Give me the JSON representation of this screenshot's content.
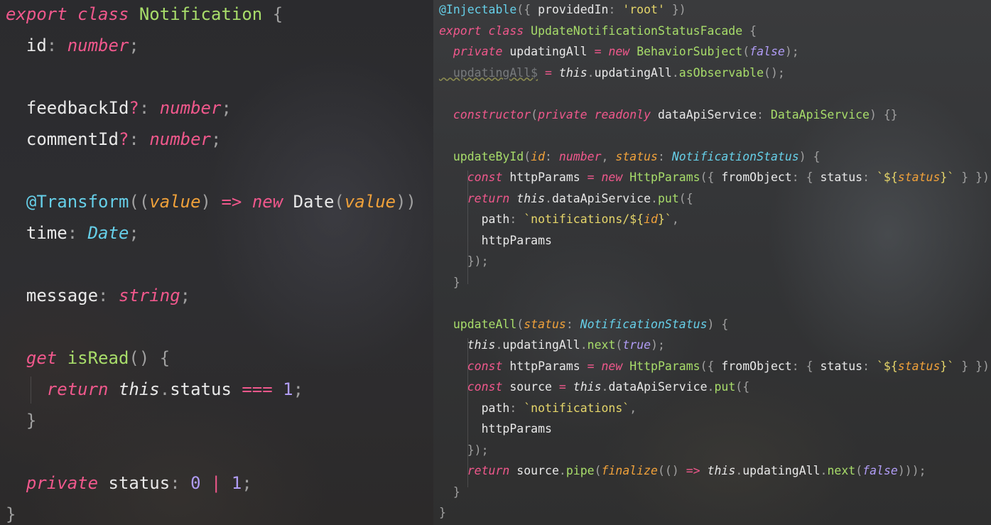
{
  "left_editor": {
    "lines": [
      [
        [
          "kw",
          "export "
        ],
        [
          "kw",
          "class "
        ],
        [
          "cls",
          "Notification"
        ],
        [
          "punc",
          " {"
        ]
      ],
      [
        [
          "ident",
          "  id"
        ],
        [
          "punc",
          ": "
        ],
        [
          "typ",
          "number"
        ],
        [
          "punc",
          ";"
        ]
      ],
      [],
      [
        [
          "ident",
          "  feedbackId"
        ],
        [
          "op",
          "?"
        ],
        [
          "punc",
          ": "
        ],
        [
          "typ",
          "number"
        ],
        [
          "punc",
          ";"
        ]
      ],
      [
        [
          "ident",
          "  commentId"
        ],
        [
          "op",
          "?"
        ],
        [
          "punc",
          ": "
        ],
        [
          "typ",
          "number"
        ],
        [
          "punc",
          ";"
        ]
      ],
      [],
      [
        [
          "dec",
          "  @Transform"
        ],
        [
          "punc",
          "(("
        ],
        [
          "param",
          "value"
        ],
        [
          "punc",
          ") "
        ],
        [
          "op",
          "=> "
        ],
        [
          "kw",
          "new "
        ],
        [
          "ident",
          "Date"
        ],
        [
          "punc",
          "("
        ],
        [
          "param",
          "value"
        ],
        [
          "punc",
          "))"
        ]
      ],
      [
        [
          "ident",
          "  time"
        ],
        [
          "punc",
          ": "
        ],
        [
          "typ-b",
          "Date"
        ],
        [
          "punc",
          ";"
        ]
      ],
      [],
      [
        [
          "ident",
          "  message"
        ],
        [
          "punc",
          ": "
        ],
        [
          "typ",
          "string"
        ],
        [
          "punc",
          ";"
        ]
      ],
      [],
      [
        [
          "kw",
          "  get "
        ],
        [
          "cls",
          "isRead"
        ],
        [
          "punc",
          "() {"
        ]
      ],
      [
        [
          "kw",
          "    return "
        ],
        [
          "this",
          "this"
        ],
        [
          "punc",
          "."
        ],
        [
          "ident",
          "status "
        ],
        [
          "op",
          "=== "
        ],
        [
          "num",
          "1"
        ],
        [
          "punc",
          ";"
        ]
      ],
      [
        [
          "punc",
          "  }"
        ]
      ],
      [],
      [
        [
          "kw",
          "  private "
        ],
        [
          "ident",
          "status"
        ],
        [
          "punc",
          ": "
        ],
        [
          "num",
          "0 "
        ],
        [
          "op",
          "| "
        ],
        [
          "num",
          "1"
        ],
        [
          "punc",
          ";"
        ]
      ],
      [
        [
          "punc",
          "}"
        ]
      ]
    ]
  },
  "right_editor": {
    "lines": [
      [
        [
          "dec",
          "@Injectable"
        ],
        [
          "punc",
          "({ "
        ],
        [
          "ident",
          "providedIn"
        ],
        [
          "punc",
          ": "
        ],
        [
          "str",
          "'root'"
        ],
        [
          "punc",
          " })"
        ]
      ],
      [
        [
          "kw",
          "export "
        ],
        [
          "kw",
          "class "
        ],
        [
          "cls",
          "UpdateNotificationStatusFacade"
        ],
        [
          "punc",
          " {"
        ]
      ],
      [
        [
          "kw",
          "  private "
        ],
        [
          "ident",
          "updatingAll "
        ],
        [
          "op",
          "= "
        ],
        [
          "kw",
          "new "
        ],
        [
          "cls",
          "BehaviorSubject"
        ],
        [
          "punc",
          "("
        ],
        [
          "bool",
          "false"
        ],
        [
          "punc",
          ");"
        ]
      ],
      [
        [
          "dim",
          "  updatingAll$"
        ],
        [
          "ident",
          " "
        ],
        [
          "op",
          "= "
        ],
        [
          "this",
          "this"
        ],
        [
          "punc",
          "."
        ],
        [
          "ident",
          "updatingAll"
        ],
        [
          "punc",
          "."
        ],
        [
          "fn",
          "asObservable"
        ],
        [
          "punc",
          "();"
        ]
      ],
      [],
      [
        [
          "kw",
          "  constructor"
        ],
        [
          "punc",
          "("
        ],
        [
          "kw",
          "private "
        ],
        [
          "kw",
          "readonly "
        ],
        [
          "ident",
          "dataApiService"
        ],
        [
          "punc",
          ": "
        ],
        [
          "tyc",
          "DataApiService"
        ],
        [
          "punc",
          ") {}"
        ]
      ],
      [],
      [
        [
          "fn",
          "  updateById"
        ],
        [
          "punc",
          "("
        ],
        [
          "param",
          "id"
        ],
        [
          "punc",
          ": "
        ],
        [
          "typ",
          "number"
        ],
        [
          "punc",
          ", "
        ],
        [
          "param",
          "status"
        ],
        [
          "punc",
          ": "
        ],
        [
          "typ-b",
          "NotificationStatus"
        ],
        [
          "punc",
          ") {"
        ]
      ],
      [
        [
          "kw",
          "    const "
        ],
        [
          "ident",
          "httpParams "
        ],
        [
          "op",
          "= "
        ],
        [
          "kw",
          "new "
        ],
        [
          "cls",
          "HttpParams"
        ],
        [
          "punc",
          "({ "
        ],
        [
          "ident",
          "fromObject"
        ],
        [
          "punc",
          ": { "
        ],
        [
          "ident",
          "status"
        ],
        [
          "punc",
          ": "
        ],
        [
          "str",
          "`${"
        ],
        [
          "tpl",
          "status"
        ],
        [
          "str",
          "}`"
        ],
        [
          "punc",
          " } });"
        ]
      ],
      [
        [
          "kw",
          "    return "
        ],
        [
          "this",
          "this"
        ],
        [
          "punc",
          "."
        ],
        [
          "ident",
          "dataApiService"
        ],
        [
          "punc",
          "."
        ],
        [
          "fn",
          "put"
        ],
        [
          "punc",
          "({"
        ]
      ],
      [
        [
          "ident",
          "      path"
        ],
        [
          "punc",
          ": "
        ],
        [
          "str",
          "`notifications/${"
        ],
        [
          "tpl",
          "id"
        ],
        [
          "str",
          "}`"
        ],
        [
          "punc",
          ","
        ]
      ],
      [
        [
          "ident",
          "      httpParams"
        ]
      ],
      [
        [
          "punc",
          "    });"
        ]
      ],
      [
        [
          "punc",
          "  }"
        ]
      ],
      [],
      [
        [
          "fn",
          "  updateAll"
        ],
        [
          "punc",
          "("
        ],
        [
          "param",
          "status"
        ],
        [
          "punc",
          ": "
        ],
        [
          "typ-b",
          "NotificationStatus"
        ],
        [
          "punc",
          ") {"
        ]
      ],
      [
        [
          "this",
          "    this"
        ],
        [
          "punc",
          "."
        ],
        [
          "ident",
          "updatingAll"
        ],
        [
          "punc",
          "."
        ],
        [
          "fn",
          "next"
        ],
        [
          "punc",
          "("
        ],
        [
          "bool",
          "true"
        ],
        [
          "punc",
          ");"
        ]
      ],
      [
        [
          "kw",
          "    const "
        ],
        [
          "ident",
          "httpParams "
        ],
        [
          "op",
          "= "
        ],
        [
          "kw",
          "new "
        ],
        [
          "cls",
          "HttpParams"
        ],
        [
          "punc",
          "({ "
        ],
        [
          "ident",
          "fromObject"
        ],
        [
          "punc",
          ": { "
        ],
        [
          "ident",
          "status"
        ],
        [
          "punc",
          ": "
        ],
        [
          "str",
          "`${"
        ],
        [
          "tpl",
          "status"
        ],
        [
          "str",
          "}`"
        ],
        [
          "punc",
          " } });"
        ]
      ],
      [
        [
          "kw",
          "    const "
        ],
        [
          "ident",
          "source "
        ],
        [
          "op",
          "= "
        ],
        [
          "this",
          "this"
        ],
        [
          "punc",
          "."
        ],
        [
          "ident",
          "dataApiService"
        ],
        [
          "punc",
          "."
        ],
        [
          "fn",
          "put"
        ],
        [
          "punc",
          "({"
        ]
      ],
      [
        [
          "ident",
          "      path"
        ],
        [
          "punc",
          ": "
        ],
        [
          "str",
          "`notifications`"
        ],
        [
          "punc",
          ","
        ]
      ],
      [
        [
          "ident",
          "      httpParams"
        ]
      ],
      [
        [
          "punc",
          "    });"
        ]
      ],
      [
        [
          "kw",
          "    return "
        ],
        [
          "ident",
          "source"
        ],
        [
          "punc",
          "."
        ],
        [
          "fn",
          "pipe"
        ],
        [
          "punc",
          "("
        ],
        [
          "tpl",
          "finalize"
        ],
        [
          "punc",
          "(() "
        ],
        [
          "op",
          "=> "
        ],
        [
          "this",
          "this"
        ],
        [
          "punc",
          "."
        ],
        [
          "ident",
          "updatingAll"
        ],
        [
          "punc",
          "."
        ],
        [
          "fn",
          "next"
        ],
        [
          "punc",
          "("
        ],
        [
          "bool",
          "false"
        ],
        [
          "punc",
          ")));"
        ]
      ],
      [
        [
          "punc",
          "  }"
        ]
      ],
      [
        [
          "punc",
          "}"
        ]
      ]
    ]
  }
}
